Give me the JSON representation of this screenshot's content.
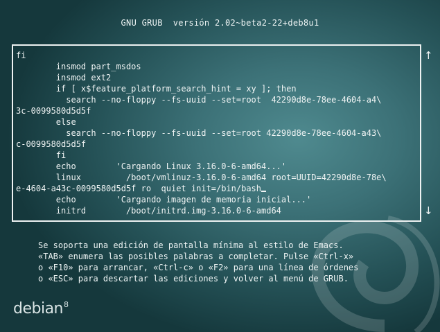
{
  "header": {
    "title": "GNU GRUB  versión 2.02~beta2-22+deb8u1"
  },
  "editor": {
    "lines": [
      "fi",
      "        insmod part_msdos",
      "        insmod ext2",
      "        if [ x$feature_platform_search_hint = xy ]; then",
      "          search --no-floppy --fs-uuid --set=root  42290d8e-78ee-4604-a4\\",
      "3c-0099580d5d5f",
      "        else",
      "          search --no-floppy --fs-uuid --set=root 42290d8e-78ee-4604-a43\\",
      "c-0099580d5d5f",
      "        fi",
      "        echo        'Cargando Linux 3.16.0-6-amd64...'",
      "        linux         /boot/vmlinuz-3.16.0-6-amd64 root=UUID=42290d8e-78e\\",
      "e-4604-a43c-0099580d5d5f ro  quiet init=/bin/bash",
      "        echo        'Cargando imagen de memoria inicial...'",
      "        initrd        /boot/initrd.img-3.16.0-6-amd64"
    ],
    "scroll_up": "↑",
    "scroll_down": "↓"
  },
  "help": {
    "lines": [
      "Se soporta una edición de pantalla mínima al estilo de Emacs.",
      "«TAB» enumera las posibles palabras a completar. Pulse «Ctrl-x»",
      "o «F10» para arrancar, «Ctrl-c» o «F2» para una línea de órdenes",
      "o «ESC» para descartar las ediciones y volver al menú de GRUB."
    ]
  },
  "logo": {
    "text": "debian",
    "version": "8"
  }
}
